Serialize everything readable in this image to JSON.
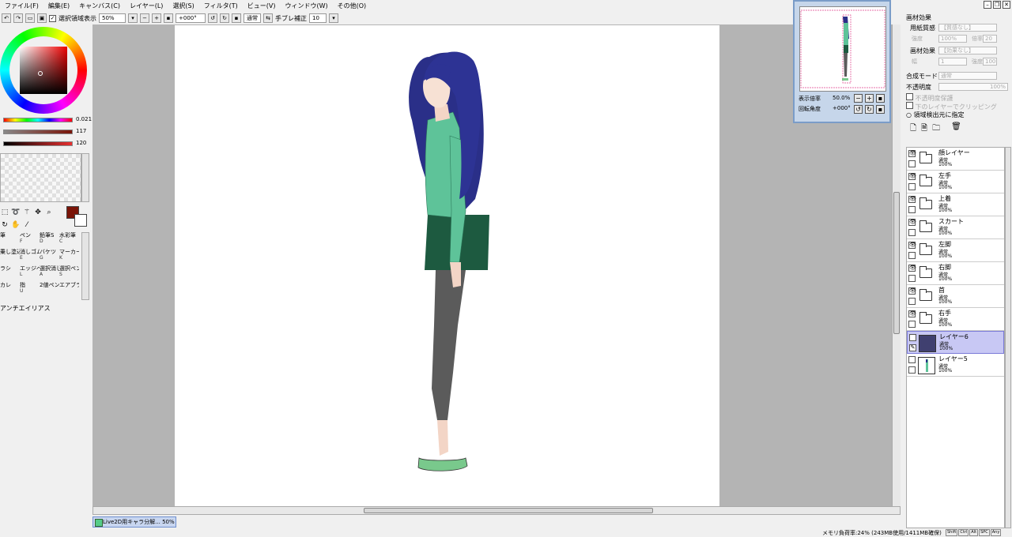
{
  "menu": [
    "ファイル(F)",
    "編集(E)",
    "キャンバス(C)",
    "レイヤー(L)",
    "選択(S)",
    "フィルタ(T)",
    "ビュー(V)",
    "ウィンドウ(W)",
    "その他(O)"
  ],
  "toolbar": {
    "show_selection_label": "選択領域表示",
    "zoom_value": "50%",
    "rotation_value": "+000°",
    "blend_value": "通常",
    "stabilizer_label": "手ブレ補正",
    "stabilizer_value": "10"
  },
  "color": {
    "main": "#7a1408",
    "sub": "#ffffff",
    "hue_value": "0.021",
    "sat_value": "117",
    "val_value": "120"
  },
  "brushes": [
    {
      "name": "筆",
      "key": ""
    },
    {
      "name": "ペン",
      "key": "F"
    },
    {
      "name": "鉛筆S",
      "key": "D"
    },
    {
      "name": "水彩筆",
      "key": "C"
    },
    {
      "name": "乗し塗込",
      "key": ""
    },
    {
      "name": "消しゴム",
      "key": "E"
    },
    {
      "name": "バケツ",
      "key": "G"
    },
    {
      "name": "マーカー",
      "key": "K"
    },
    {
      "name": "ラシ",
      "key": ""
    },
    {
      "name": "エッジペン",
      "key": "L"
    },
    {
      "name": "選択消し",
      "key": "A"
    },
    {
      "name": "選択ペン",
      "key": "S"
    },
    {
      "name": "カレ",
      "key": ""
    },
    {
      "name": "指",
      "key": "U"
    },
    {
      "name": "2値ペン",
      "key": ""
    },
    {
      "name": "エアブラシ",
      "key": ""
    }
  ],
  "antialias_label": "アンチエイリアス",
  "navigator": {
    "zoom_label": "表示倍率",
    "zoom_value": "50.0%",
    "rotation_label": "回転角度",
    "rotation_value": "+000°"
  },
  "paper_panel": {
    "title": "画材効果",
    "texture_label": "用紙質感",
    "texture_value": "【質感なし】",
    "strength_label": "強度",
    "strength_value": "100%",
    "multiplier_label": "倍率",
    "multiplier_value": "20",
    "effect_label": "画材効果",
    "effect_value": "【効果なし】",
    "width_label": "幅",
    "width_value": "1",
    "effect_strength_label": "強度",
    "effect_strength_value": "100",
    "blend_label": "合成モード",
    "blend_value": "通常",
    "opacity_label": "不透明度",
    "opacity_value": "100%",
    "protect_label": "不透明度保護",
    "clip_label": "下のレイヤーでクリッピング",
    "source_label": "領域検出元に指定"
  },
  "layers": [
    {
      "name": "顔レイヤー",
      "mode": "通常",
      "opacity": "100%",
      "type": "folder",
      "visible": true,
      "selected": false
    },
    {
      "name": "左手",
      "mode": "通常",
      "opacity": "100%",
      "type": "folder",
      "visible": true,
      "selected": false
    },
    {
      "name": "上着",
      "mode": "通常",
      "opacity": "100%",
      "type": "folder",
      "visible": true,
      "selected": false
    },
    {
      "name": "スカート",
      "mode": "通常",
      "opacity": "100%",
      "type": "folder",
      "visible": true,
      "selected": false
    },
    {
      "name": "左脚",
      "mode": "通常",
      "opacity": "100%",
      "type": "folder",
      "visible": true,
      "selected": false
    },
    {
      "name": "右脚",
      "mode": "通常",
      "opacity": "100%",
      "type": "folder",
      "visible": true,
      "selected": false
    },
    {
      "name": "首",
      "mode": "通常",
      "opacity": "100%",
      "type": "folder",
      "visible": true,
      "selected": false
    },
    {
      "name": "右手",
      "mode": "通常",
      "opacity": "100%",
      "type": "folder",
      "visible": true,
      "selected": false
    },
    {
      "name": "レイヤー6",
      "mode": "通常",
      "opacity": "100%",
      "type": "layer-dark",
      "visible": false,
      "selected": true
    },
    {
      "name": "レイヤー5",
      "mode": "通常",
      "opacity": "100%",
      "type": "layer-figure",
      "visible": false,
      "selected": false
    }
  ],
  "taskbar": {
    "doc_name": "Live2D用キャラ分解...",
    "doc_zoom": "50%"
  },
  "status": {
    "memory": "メモリ負荷率:24% (243MB使用/1411MB確保)",
    "keys": [
      "Shift",
      "Ctrl",
      "Alt",
      "SPC",
      "Any"
    ]
  }
}
